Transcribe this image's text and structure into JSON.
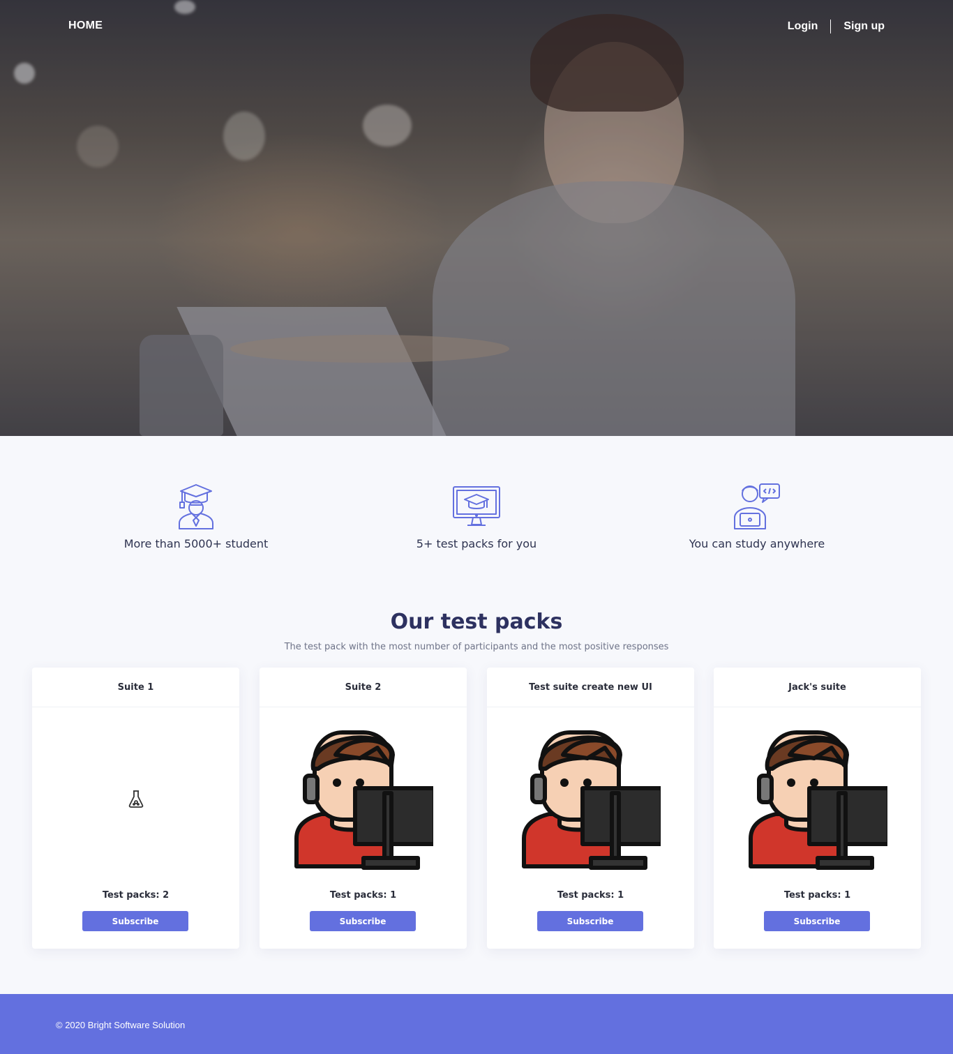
{
  "nav": {
    "home": "HOME",
    "login": "Login",
    "signup": "Sign up"
  },
  "features": [
    {
      "icon": "graduate-icon",
      "label": "More than 5000+ student"
    },
    {
      "icon": "monitor-graduation-icon",
      "label": "5+ test packs for you"
    },
    {
      "icon": "person-laptop-code-icon",
      "label": "You can study anywhere"
    }
  ],
  "section": {
    "title": "Our test packs",
    "subtitle": "The test pack with the most number of participants and the most positive responses"
  },
  "cards": [
    {
      "title": "Suite 1",
      "count": "Test packs: 2",
      "button": "Subscribe",
      "image": "flask-icon"
    },
    {
      "title": "Suite 2",
      "count": "Test packs: 1",
      "button": "Subscribe",
      "image": "developer-avatar"
    },
    {
      "title": "Test suite create new UI",
      "count": "Test packs: 1",
      "button": "Subscribe",
      "image": "developer-avatar"
    },
    {
      "title": "Jack's suite",
      "count": "Test packs: 1",
      "button": "Subscribe",
      "image": "developer-avatar"
    }
  ],
  "footer": {
    "copyright": "© 2020 Bright Software Solution"
  },
  "colors": {
    "accent": "#6370df",
    "heading": "#2d3160",
    "icon": "#6370df"
  }
}
